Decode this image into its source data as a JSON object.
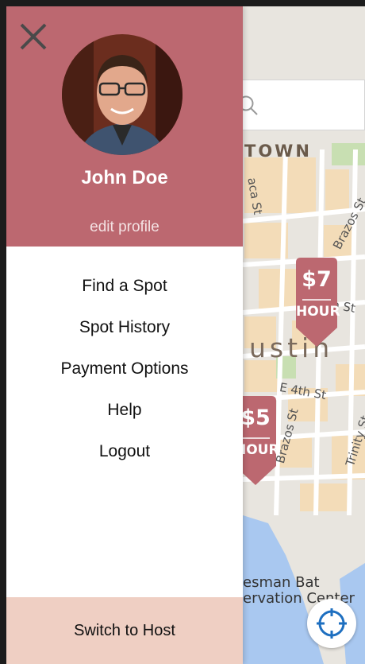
{
  "user": {
    "name": "John Doe",
    "edit_profile_label": "edit profile"
  },
  "menu": {
    "items": [
      {
        "label": "Find a Spot"
      },
      {
        "label": "Spot History"
      },
      {
        "label": "Payment Options"
      },
      {
        "label": "Help"
      },
      {
        "label": "Logout"
      }
    ],
    "switch_label": "Switch to Host"
  },
  "map": {
    "labels": {
      "downtown": "TOWN",
      "austin": "ustin",
      "street_lavaca": "aca St",
      "street_brazos_top": "Brazos St",
      "street_4th": "E 4th St",
      "street_st": "h St",
      "street_brazos_bottom": "Brazos St",
      "street_trinity": "Trinity St",
      "bat_line1": "esman Bat",
      "bat_line2": "ervation Center"
    },
    "pins": [
      {
        "amount": "$7",
        "unit": "HOUR"
      },
      {
        "amount": "$5",
        "unit": "HOUR"
      }
    ]
  },
  "colors": {
    "accent": "#bc6870",
    "switch_bg": "#efcfc3",
    "water": "#a9c8f0",
    "block": "#f3dcb8"
  }
}
